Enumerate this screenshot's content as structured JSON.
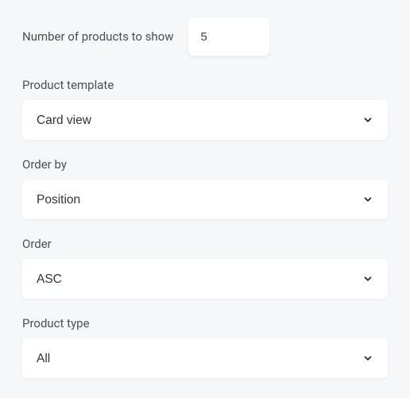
{
  "number_of_products": {
    "label": "Number of products to show",
    "value": "5"
  },
  "product_template": {
    "label": "Product template",
    "value": "Card view"
  },
  "order_by": {
    "label": "Order by",
    "value": "Position"
  },
  "order": {
    "label": "Order",
    "value": "ASC"
  },
  "product_type": {
    "label": "Product type",
    "value": "All"
  }
}
